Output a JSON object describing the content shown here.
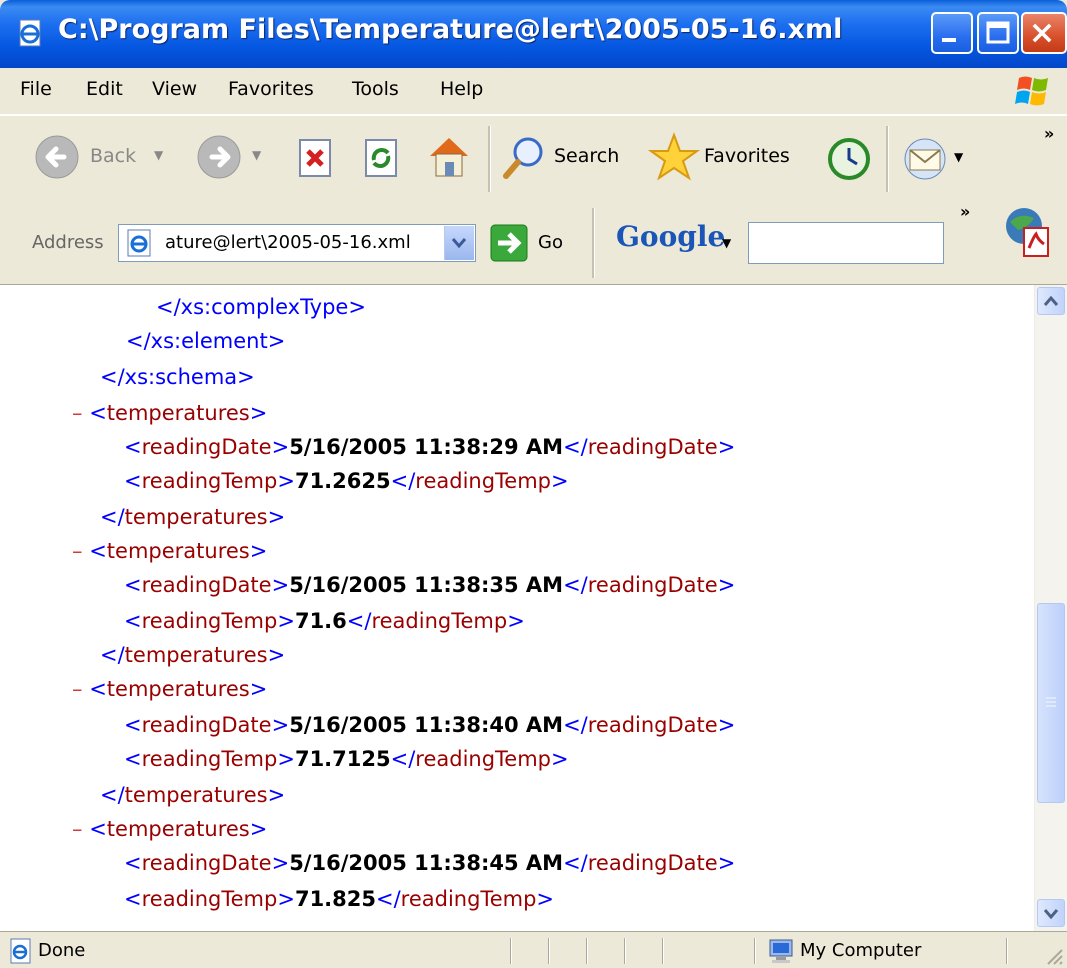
{
  "window": {
    "title": "C:\\Program Files\\Temperature@lert\\2005-05-16.xml"
  },
  "menu": {
    "file": "File",
    "edit": "Edit",
    "view": "View",
    "favorites": "Favorites",
    "tools": "Tools",
    "help": "Help"
  },
  "toolbar": {
    "back": "Back",
    "search": "Search",
    "favorites": "Favorites",
    "more": "»"
  },
  "address": {
    "label": "Address",
    "value": "ature@lert\\2005-05-16.xml",
    "go": "Go"
  },
  "google": {
    "logo": "Google",
    "more": "»",
    "search_value": ""
  },
  "xml": {
    "close_complextype": "</xs:complexType>",
    "close_element": "</xs:element>",
    "close_schema": "</xs:schema>",
    "collapse_symbol": "–",
    "temperatures_tag": "temperatures",
    "reading_date_tag": "readingDate",
    "reading_temp_tag": "readingTemp",
    "records": [
      {
        "date": "5/16/2005 11:38:29 AM",
        "temp": "71.2625"
      },
      {
        "date": "5/16/2005 11:38:35 AM",
        "temp": "71.6"
      },
      {
        "date": "5/16/2005 11:38:40 AM",
        "temp": "71.7125"
      },
      {
        "date": "5/16/2005 11:38:45 AM",
        "temp": "71.825"
      }
    ]
  },
  "status": {
    "text": "Done",
    "zone": "My Computer"
  },
  "colors": {
    "tag": "#990000",
    "bracket": "#0000ff",
    "collapse": "#d33a3a",
    "titlebar": "#0556e0"
  }
}
